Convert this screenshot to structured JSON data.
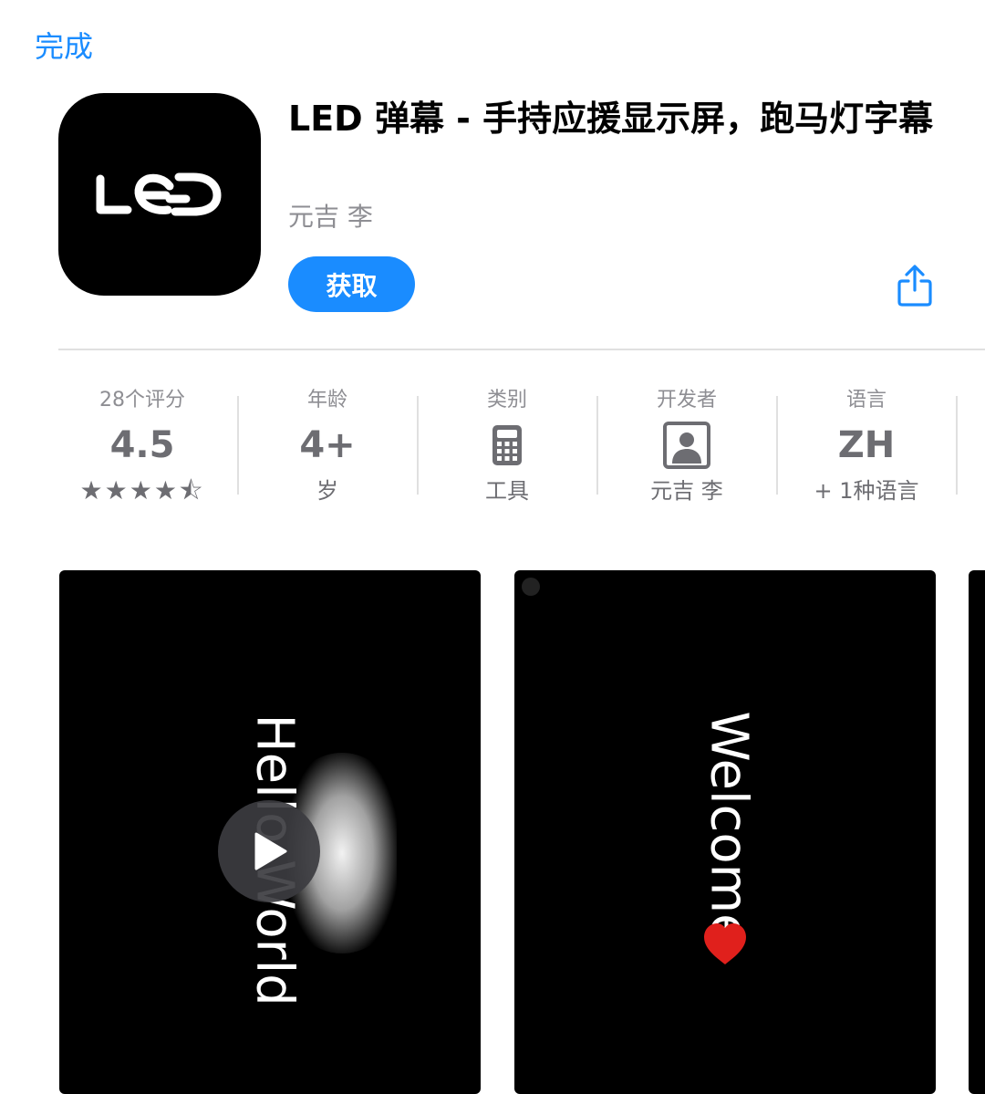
{
  "header": {
    "done_label": "完成"
  },
  "app": {
    "icon_label": "LED",
    "title": "LED 弹幕 - 手持应援显示屏，跑马灯字幕",
    "developer": "元吉 李",
    "get_label": "获取",
    "accent_color": "#1a8cff"
  },
  "info": [
    {
      "label": "28个评分",
      "value": "4.5",
      "stars": "★★★★⯪",
      "rating": 4.5
    },
    {
      "label": "年龄",
      "value": "4+",
      "sub": "岁"
    },
    {
      "label": "类别",
      "icon": "calculator-icon",
      "sub": "工具"
    },
    {
      "label": "开发者",
      "icon": "person-icon",
      "sub": "元吉 李"
    },
    {
      "label": "语言",
      "value": "ZH",
      "sub": "+ 1种语言"
    }
  ],
  "screenshots": [
    {
      "text": "Hello World",
      "has_video": true
    },
    {
      "text": "Welcome",
      "emoji": "heart"
    }
  ]
}
